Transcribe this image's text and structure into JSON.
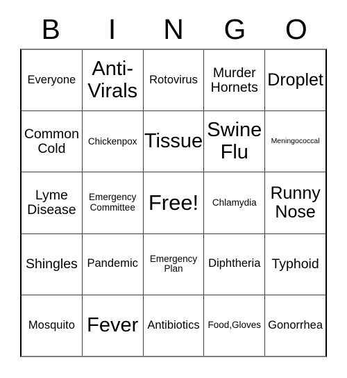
{
  "card": {
    "header": {
      "letters": [
        "B",
        "I",
        "N",
        "G",
        "O"
      ]
    },
    "rows": [
      {
        "cells": [
          {
            "text": "Everyone",
            "size": "md"
          },
          {
            "text": "Anti-Virals",
            "size": "xxl"
          },
          {
            "text": "Rotovirus",
            "size": "md"
          },
          {
            "text": "Murder Hornets",
            "size": "lg"
          },
          {
            "text": "Droplet",
            "size": "xl"
          }
        ]
      },
      {
        "cells": [
          {
            "text": "Common Cold",
            "size": "lg"
          },
          {
            "text": "Chickenpox",
            "size": "sm"
          },
          {
            "text": "Tissue",
            "size": "xxl"
          },
          {
            "text": "Swine Flu",
            "size": "xxl"
          },
          {
            "text": "Meningococcal",
            "size": "xs"
          }
        ]
      },
      {
        "cells": [
          {
            "text": "Lyme Disease",
            "size": "lg"
          },
          {
            "text": "Emergency Committee",
            "size": "sm"
          },
          {
            "text": "Free!",
            "size": "free"
          },
          {
            "text": "Chlamydia",
            "size": "sm"
          },
          {
            "text": "Runny Nose",
            "size": "xl"
          }
        ]
      },
      {
        "cells": [
          {
            "text": "Shingles",
            "size": "lg"
          },
          {
            "text": "Pandemic",
            "size": "md"
          },
          {
            "text": "Emergency Plan",
            "size": "sm"
          },
          {
            "text": "Diphtheria",
            "size": "md"
          },
          {
            "text": "Typhoid",
            "size": "lg"
          }
        ]
      },
      {
        "cells": [
          {
            "text": "Mosquito",
            "size": "md"
          },
          {
            "text": "Fever",
            "size": "xxl"
          },
          {
            "text": "Antibiotics",
            "size": "md"
          },
          {
            "text": "Food,Gloves",
            "size": "sm"
          },
          {
            "text": "Gonorrhea",
            "size": "md"
          }
        ]
      }
    ]
  }
}
